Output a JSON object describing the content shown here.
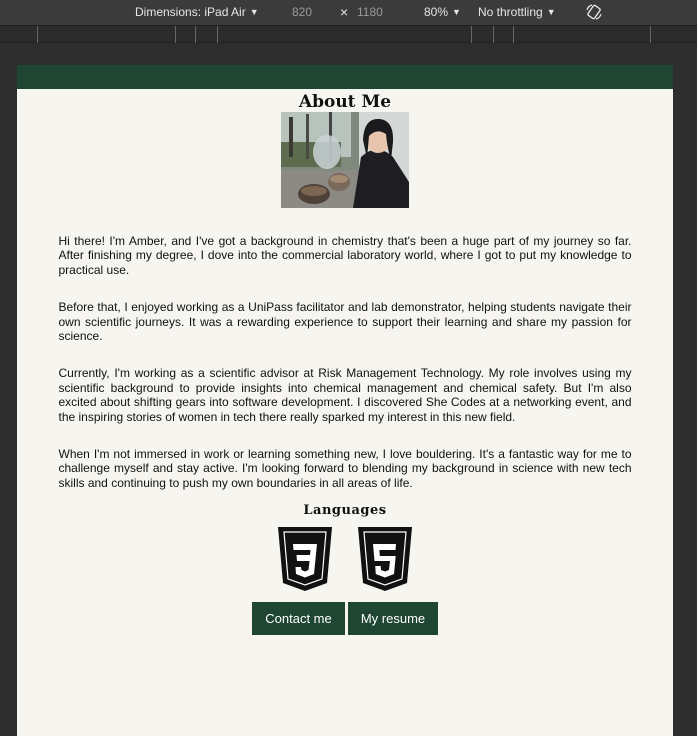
{
  "devtools": {
    "dimensions_label": "Dimensions: iPad Air",
    "width": "820",
    "times": "×",
    "height": "1180",
    "zoom": "80%",
    "throttling": "No throttling",
    "rotate_icon": "rotate-icon"
  },
  "page": {
    "title": "About Me",
    "photo_alt": "profile photo",
    "bio": [
      "Hi there! I'm Amber, and I've got a background in chemistry that's been a huge part of my journey so far. After finishing my degree, I dove into the commercial laboratory world, where I got to put my knowledge to practical use.",
      "Before that, I enjoyed working as a UniPass facilitator and lab demonstrator, helping students navigate their own scientific journeys. It was a rewarding experience to support their learning and share my passion for science.",
      "Currently, I'm working as a scientific advisor at Risk Management Technology. My role involves using my scientific background to provide insights into chemical management and chemical safety. But I'm also excited about shifting gears into software development. I discovered She Codes at a networking event, and the inspiring stories of women in tech there really sparked my interest in this new field.",
      "When I'm not immersed in work or learning something new, I love bouldering. It's a fantastic way for me to challenge myself and stay active. I'm looking forward to blending my background in science with new tech skills and continuing to push my own boundaries in all areas of life."
    ],
    "languages_title": "Languages",
    "languages": [
      {
        "icon": "css3-icon",
        "glyph": "3"
      },
      {
        "icon": "html5-icon",
        "glyph": "5"
      }
    ],
    "contact_label": "Contact me",
    "resume_label": "My resume"
  },
  "colors": {
    "brand_green": "#1e4633",
    "page_background": "#f6f5ef",
    "devtools_background": "#3b3b3b"
  }
}
